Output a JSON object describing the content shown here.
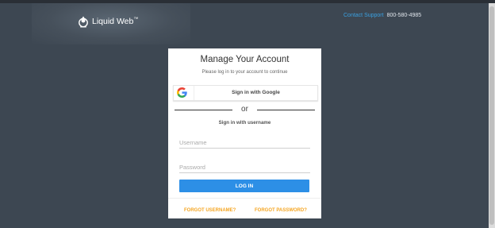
{
  "header": {
    "logo_text": "Liquid Web",
    "logo_tm": "™",
    "contact_link": "Contact Support",
    "phone": "800-580-4985"
  },
  "card": {
    "title": "Manage Your Account",
    "subtitle": "Please log in to your account to continue",
    "google_button": "Sign in with Google",
    "or_text": "or",
    "username_heading": "Sign in with username",
    "username_placeholder": "Username",
    "password_placeholder": "Password",
    "login_button": "LOG IN",
    "forgot_username": "FORGOT USERNAME?",
    "forgot_password": "FORGOT PASSWORD?"
  },
  "colors": {
    "background": "#3d4752",
    "accent_blue": "#2d8fe6",
    "link_orange": "#f5a623",
    "contact_link": "#3aa0e0"
  },
  "icons": {
    "logo": "liquid-web-logo-icon",
    "google": "google-g-icon"
  }
}
